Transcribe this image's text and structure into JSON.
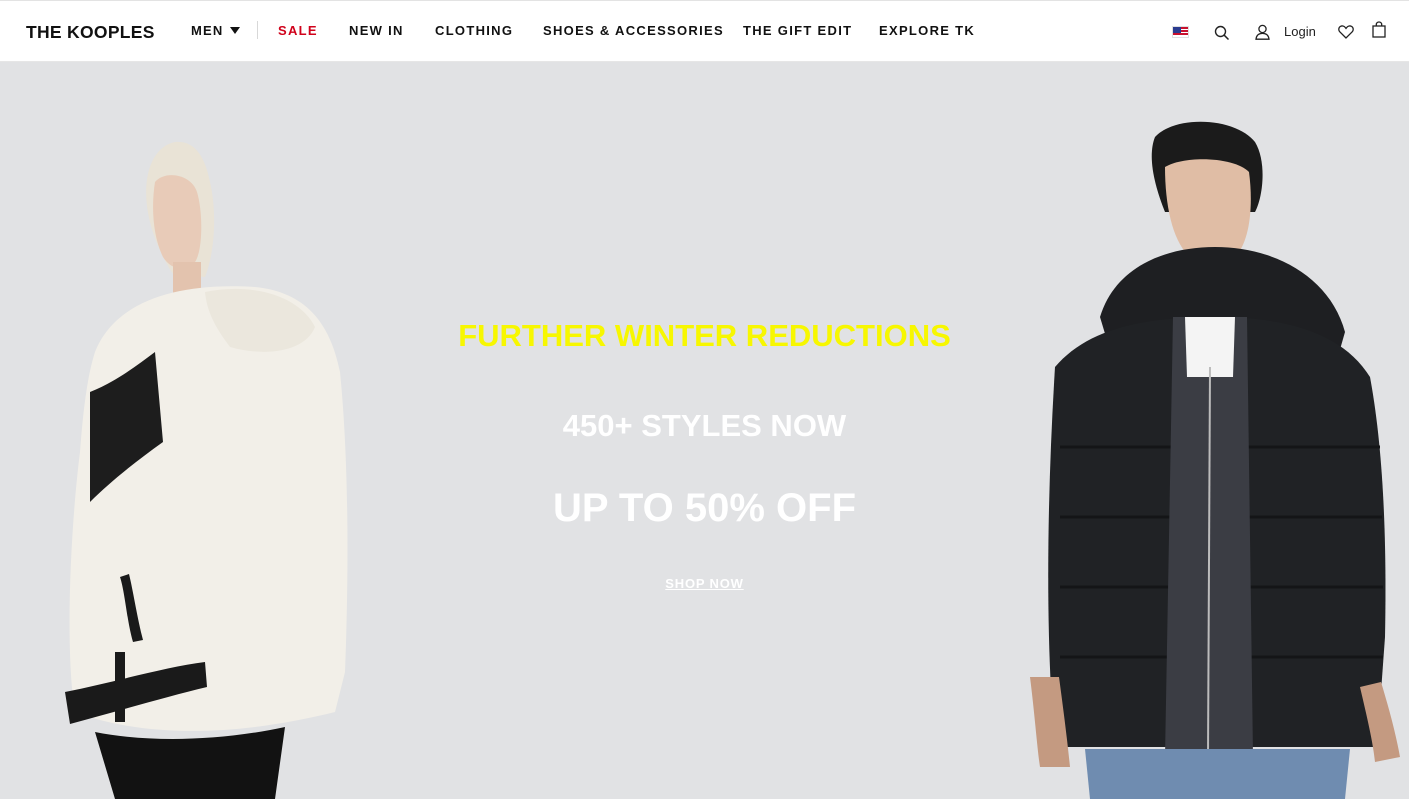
{
  "header": {
    "logo": "THE KOOPLES",
    "nav": {
      "men": "MEN",
      "sale": "SALE",
      "new_in": "NEW IN",
      "clothing": "CLOTHING",
      "shoes_accessories": "SHOES & ACCESSORIES",
      "gift_edit": "THE GIFT EDIT",
      "explore": "EXPLORE TK"
    },
    "utility": {
      "flag_icon": "us-flag-icon",
      "search_icon": "search-icon",
      "account_icon": "user-icon",
      "login": "Login",
      "wishlist_icon": "heart-icon",
      "bag_icon": "shopping-bag-icon"
    }
  },
  "hero": {
    "headline": "FURTHER WINTER REDUCTIONS",
    "subline": "450+ STYLES NOW",
    "offer": "UP TO 50% OFF",
    "cta": "SHOP NOW",
    "colors": {
      "background": "#e1e2e4",
      "headline": "#f7f700",
      "text": "#ffffff",
      "sale": "#d0021b"
    }
  }
}
